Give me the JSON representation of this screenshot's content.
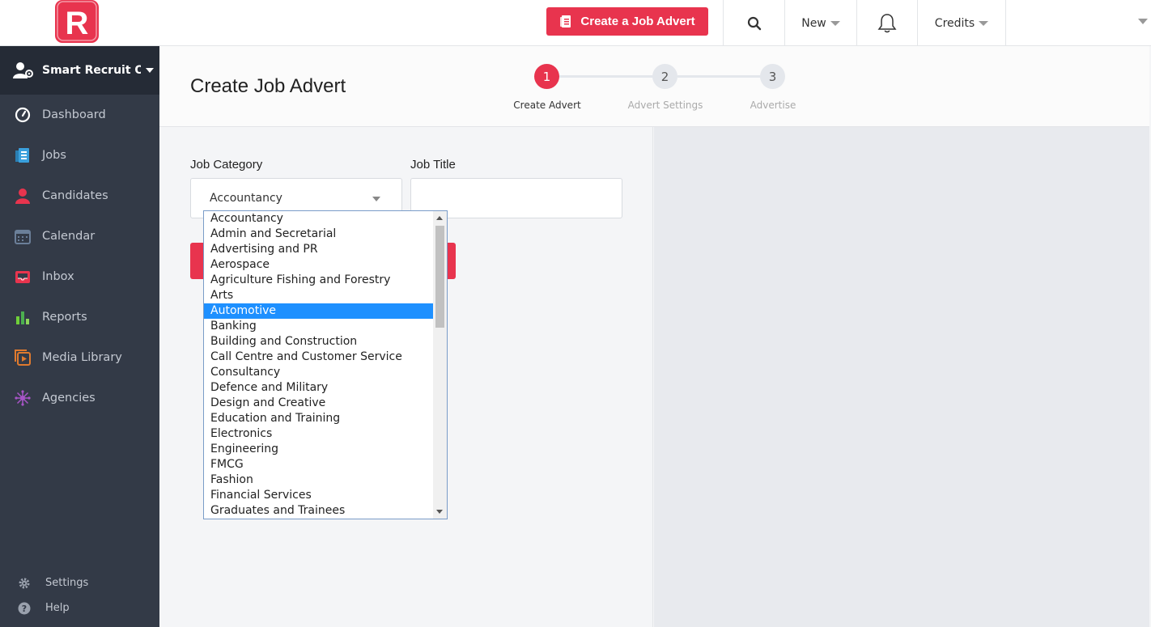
{
  "topbar": {
    "logo_letter": "R",
    "cta_label": "Create a Job Advert",
    "new_label": "New",
    "credits_label": "Credits"
  },
  "sidebar": {
    "org_name": "Smart Recruit O...",
    "items": [
      {
        "label": "Dashboard",
        "icon": "dashboard-icon"
      },
      {
        "label": "Jobs",
        "icon": "jobs-icon"
      },
      {
        "label": "Candidates",
        "icon": "candidates-icon"
      },
      {
        "label": "Calendar",
        "icon": "calendar-icon"
      },
      {
        "label": "Inbox",
        "icon": "inbox-icon"
      },
      {
        "label": "Reports",
        "icon": "reports-icon"
      },
      {
        "label": "Media Library",
        "icon": "media-library-icon"
      },
      {
        "label": "Agencies",
        "icon": "agencies-icon"
      }
    ],
    "settings_label": "Settings",
    "help_label": "Help"
  },
  "page": {
    "title": "Create Job Advert",
    "steps": [
      {
        "number": "1",
        "label": "Create Advert",
        "active": true
      },
      {
        "number": "2",
        "label": "Advert Settings",
        "active": false
      },
      {
        "number": "3",
        "label": "Advertise",
        "active": false
      }
    ]
  },
  "form": {
    "category_label": "Job Category",
    "category_value": "Accountancy",
    "title_label": "Job Title",
    "title_value": ""
  },
  "dropdown": {
    "selected": "Automotive",
    "options": [
      "Accountancy",
      "Admin and Secretarial",
      "Advertising and PR",
      "Aerospace",
      "Agriculture Fishing and Forestry",
      "Arts",
      "Automotive",
      "Banking",
      "Building and Construction",
      "Call Centre and Customer Service",
      "Consultancy",
      "Defence and Military",
      "Design and Creative",
      "Education and Training",
      "Electronics",
      "Engineering",
      "FMCG",
      "Fashion",
      "Financial Services",
      "Graduates and Trainees"
    ]
  },
  "colors": {
    "accent": "#e8344e",
    "sidebar_bg": "#333a47",
    "sidebar_header_bg": "#252b36",
    "selection": "#1e90ff"
  }
}
